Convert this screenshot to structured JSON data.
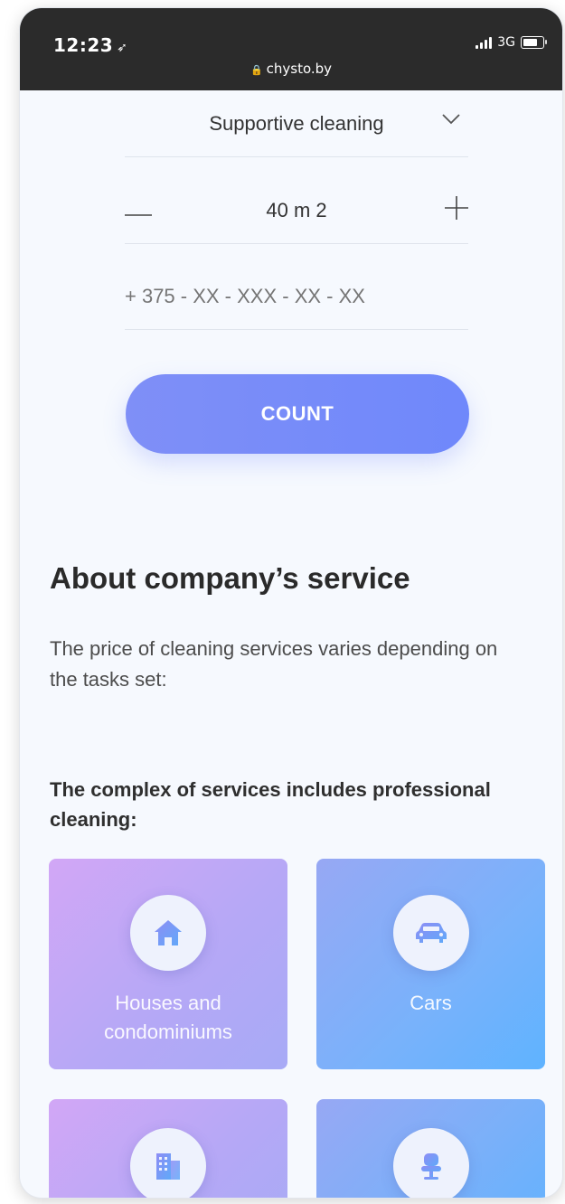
{
  "status": {
    "time": "12:23",
    "network": "3G",
    "url": "chysto.by"
  },
  "form": {
    "service_type": "Supportive cleaning",
    "area_value": "40 m 2",
    "phone_placeholder": "+ 375 - XX - XXX - XX - XX",
    "submit_label": "COUNT"
  },
  "about": {
    "title": "About company’s service",
    "text": "The price of cleaning services varies depending on the tasks set:",
    "subtitle": "The complex of services includes professional cleaning:"
  },
  "services": [
    {
      "label": "Houses and condominiums",
      "icon": "house-icon"
    },
    {
      "label": "Cars",
      "icon": "car-icon"
    },
    {
      "label": "",
      "icon": "office-building-icon"
    },
    {
      "label": "",
      "icon": "chair-icon"
    }
  ],
  "colors": {
    "accent": "#6f88fb",
    "status_bar": "#2b2b2b",
    "background": "#f6f9fe"
  }
}
